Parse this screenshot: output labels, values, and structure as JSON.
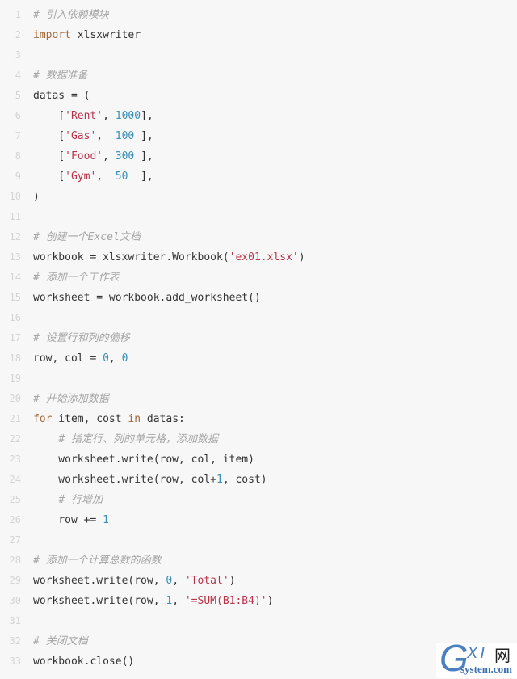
{
  "code": {
    "language": "python",
    "lines": [
      {
        "n": "1",
        "tokens": [
          {
            "t": "comment",
            "v": "# 引入依赖模块"
          }
        ]
      },
      {
        "n": "2",
        "tokens": [
          {
            "t": "keyword",
            "v": "import"
          },
          {
            "t": "plain",
            "v": " xlsxwriter"
          }
        ]
      },
      {
        "n": "3",
        "tokens": []
      },
      {
        "n": "4",
        "tokens": [
          {
            "t": "comment",
            "v": "# 数据准备"
          }
        ]
      },
      {
        "n": "5",
        "tokens": [
          {
            "t": "plain",
            "v": "datas = ("
          }
        ]
      },
      {
        "n": "6",
        "tokens": [
          {
            "t": "plain",
            "v": "    ["
          },
          {
            "t": "string",
            "v": "'Rent'"
          },
          {
            "t": "plain",
            "v": ", "
          },
          {
            "t": "number",
            "v": "1000"
          },
          {
            "t": "plain",
            "v": "],"
          }
        ]
      },
      {
        "n": "7",
        "tokens": [
          {
            "t": "plain",
            "v": "    ["
          },
          {
            "t": "string",
            "v": "'Gas'"
          },
          {
            "t": "plain",
            "v": ",  "
          },
          {
            "t": "number",
            "v": "100"
          },
          {
            "t": "plain",
            "v": " ],"
          }
        ]
      },
      {
        "n": "8",
        "tokens": [
          {
            "t": "plain",
            "v": "    ["
          },
          {
            "t": "string",
            "v": "'Food'"
          },
          {
            "t": "plain",
            "v": ", "
          },
          {
            "t": "number",
            "v": "300"
          },
          {
            "t": "plain",
            "v": " ],"
          }
        ]
      },
      {
        "n": "9",
        "tokens": [
          {
            "t": "plain",
            "v": "    ["
          },
          {
            "t": "string",
            "v": "'Gym'"
          },
          {
            "t": "plain",
            "v": ",  "
          },
          {
            "t": "number",
            "v": "50"
          },
          {
            "t": "plain",
            "v": "  ],"
          }
        ]
      },
      {
        "n": "10",
        "tokens": [
          {
            "t": "plain",
            "v": ")"
          }
        ]
      },
      {
        "n": "11",
        "tokens": []
      },
      {
        "n": "12",
        "tokens": [
          {
            "t": "comment",
            "v": "# 创建一个Excel文档"
          }
        ]
      },
      {
        "n": "13",
        "tokens": [
          {
            "t": "plain",
            "v": "workbook = xlsxwriter.Workbook("
          },
          {
            "t": "string",
            "v": "'ex01.xlsx'"
          },
          {
            "t": "plain",
            "v": ")"
          }
        ]
      },
      {
        "n": "14",
        "tokens": [
          {
            "t": "comment",
            "v": "# 添加一个工作表"
          }
        ]
      },
      {
        "n": "15",
        "tokens": [
          {
            "t": "plain",
            "v": "worksheet = workbook.add_worksheet()"
          }
        ]
      },
      {
        "n": "16",
        "tokens": []
      },
      {
        "n": "17",
        "tokens": [
          {
            "t": "comment",
            "v": "# 设置行和列的偏移"
          }
        ]
      },
      {
        "n": "18",
        "tokens": [
          {
            "t": "plain",
            "v": "row, col = "
          },
          {
            "t": "number",
            "v": "0"
          },
          {
            "t": "plain",
            "v": ", "
          },
          {
            "t": "number",
            "v": "0"
          }
        ]
      },
      {
        "n": "19",
        "tokens": []
      },
      {
        "n": "20",
        "tokens": [
          {
            "t": "comment",
            "v": "# 开始添加数据"
          }
        ]
      },
      {
        "n": "21",
        "tokens": [
          {
            "t": "keyword",
            "v": "for"
          },
          {
            "t": "plain",
            "v": " item, cost "
          },
          {
            "t": "keyword",
            "v": "in"
          },
          {
            "t": "plain",
            "v": " datas:"
          }
        ]
      },
      {
        "n": "22",
        "tokens": [
          {
            "t": "plain",
            "v": "    "
          },
          {
            "t": "comment",
            "v": "# 指定行、列的单元格，添加数据"
          }
        ]
      },
      {
        "n": "23",
        "tokens": [
          {
            "t": "plain",
            "v": "    worksheet.write(row, col, item)"
          }
        ]
      },
      {
        "n": "24",
        "tokens": [
          {
            "t": "plain",
            "v": "    worksheet.write(row, col+"
          },
          {
            "t": "number",
            "v": "1"
          },
          {
            "t": "plain",
            "v": ", cost)"
          }
        ]
      },
      {
        "n": "25",
        "tokens": [
          {
            "t": "plain",
            "v": "    "
          },
          {
            "t": "comment",
            "v": "# 行增加"
          }
        ]
      },
      {
        "n": "26",
        "tokens": [
          {
            "t": "plain",
            "v": "    row += "
          },
          {
            "t": "number",
            "v": "1"
          }
        ]
      },
      {
        "n": "27",
        "tokens": []
      },
      {
        "n": "28",
        "tokens": [
          {
            "t": "comment",
            "v": "# 添加一个计算总数的函数"
          }
        ]
      },
      {
        "n": "29",
        "tokens": [
          {
            "t": "plain",
            "v": "worksheet.write(row, "
          },
          {
            "t": "number",
            "v": "0"
          },
          {
            "t": "plain",
            "v": ", "
          },
          {
            "t": "string",
            "v": "'Total'"
          },
          {
            "t": "plain",
            "v": ")"
          }
        ]
      },
      {
        "n": "30",
        "tokens": [
          {
            "t": "plain",
            "v": "worksheet.write(row, "
          },
          {
            "t": "number",
            "v": "1"
          },
          {
            "t": "plain",
            "v": ", "
          },
          {
            "t": "string",
            "v": "'=SUM(B1:B4)'"
          },
          {
            "t": "plain",
            "v": ")"
          }
        ]
      },
      {
        "n": "31",
        "tokens": []
      },
      {
        "n": "32",
        "tokens": [
          {
            "t": "comment",
            "v": "# 关闭文档"
          }
        ]
      },
      {
        "n": "33",
        "tokens": [
          {
            "t": "plain",
            "v": "workbook.close()"
          }
        ]
      }
    ]
  },
  "watermark": {
    "logo_letter": "G",
    "logo_xi": "XI",
    "logo_cn": "网",
    "site": "system.com"
  },
  "colors": {
    "background": "#f7f7f7",
    "comment": "#a5a5a5",
    "keyword": "#a26a3a",
    "string": "#b8334a",
    "number": "#3a8fb7",
    "plain": "#333333",
    "line_number": "#d4d4d4"
  }
}
